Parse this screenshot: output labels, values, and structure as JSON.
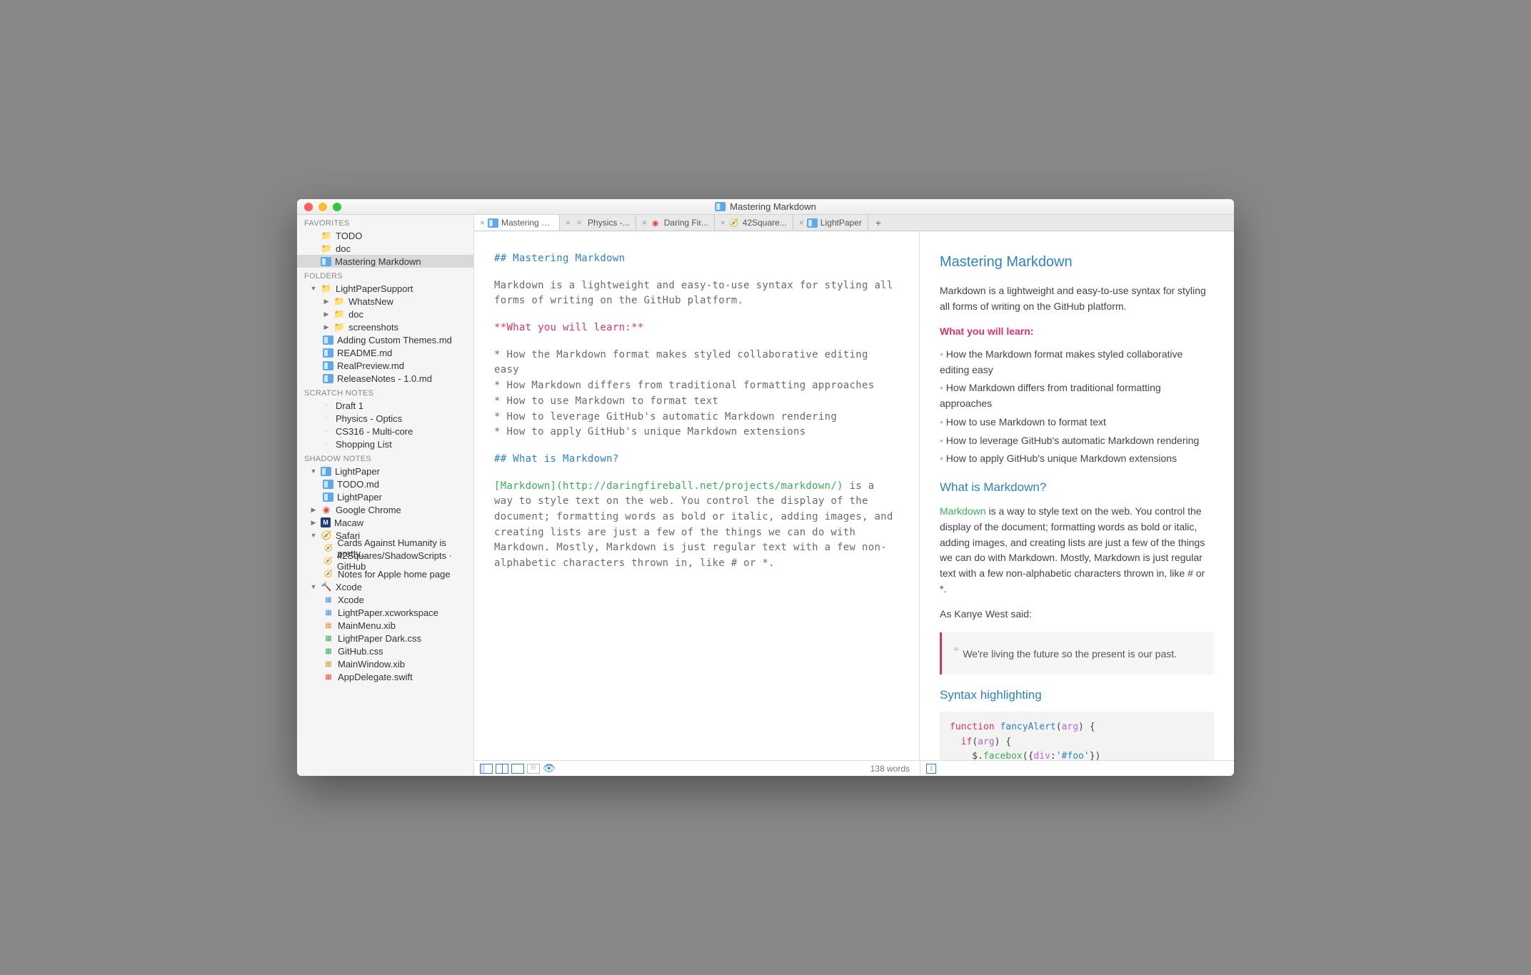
{
  "window": {
    "title": "Mastering Markdown"
  },
  "sidebar": {
    "favorites_h": "FAVORITES",
    "favorites": [
      {
        "label": "TODO",
        "icon": "folder"
      },
      {
        "label": "doc",
        "icon": "folder"
      },
      {
        "label": "Mastering Markdown",
        "icon": "app",
        "selected": true
      }
    ],
    "folders_h": "FOLDERS",
    "folders": [
      {
        "label": "LightPaperSupport",
        "icon": "folder",
        "disc": "▼",
        "depth": 1
      },
      {
        "label": "WhatsNew",
        "icon": "folder",
        "disc": "▶",
        "depth": 2
      },
      {
        "label": "doc",
        "icon": "folder",
        "disc": "▶",
        "depth": 2
      },
      {
        "label": "screenshots",
        "icon": "folder",
        "disc": "▶",
        "depth": 2
      },
      {
        "label": "Adding Custom Themes.md",
        "icon": "app",
        "depth": 2
      },
      {
        "label": "README.md",
        "icon": "app",
        "depth": 2
      },
      {
        "label": "RealPreview.md",
        "icon": "app",
        "depth": 2
      },
      {
        "label": "ReleaseNotes - 1.0.md",
        "icon": "app",
        "depth": 2
      }
    ],
    "scratch_h": "SCRATCH NOTES",
    "scratch": [
      {
        "label": "Draft 1"
      },
      {
        "label": "Physics - Optics"
      },
      {
        "label": "CS316 - Multi-core"
      },
      {
        "label": "Shopping List"
      }
    ],
    "shadow_h": "SHADOW NOTES",
    "shadow": [
      {
        "label": "LightPaper",
        "icon": "app",
        "disc": "▼",
        "depth": 1
      },
      {
        "label": "TODO.md",
        "icon": "app",
        "depth": 2
      },
      {
        "label": "LightPaper",
        "icon": "app",
        "depth": 2
      },
      {
        "label": "Google Chrome",
        "icon": "chrome",
        "disc": "▶",
        "depth": 1
      },
      {
        "label": "Macaw",
        "icon": "macaw",
        "disc": "▶",
        "depth": 1
      },
      {
        "label": "Safari",
        "icon": "safari",
        "disc": "▼",
        "depth": 1
      },
      {
        "label": "Cards Against Humanity is pretty...",
        "icon": "safaridoc",
        "depth": 2
      },
      {
        "label": "42Squares/ShadowScripts · GitHub",
        "icon": "safaridoc",
        "depth": 2
      },
      {
        "label": "Notes for Apple home page",
        "icon": "safaridoc",
        "depth": 2
      },
      {
        "label": "Xcode",
        "icon": "xcode",
        "disc": "▼",
        "depth": 1
      },
      {
        "label": "Xcode",
        "icon": "xcodefile",
        "depth": 2
      },
      {
        "label": "LightPaper.xcworkspace",
        "icon": "xcodefile",
        "depth": 2
      },
      {
        "label": "MainMenu.xib",
        "icon": "xib",
        "depth": 2
      },
      {
        "label": "LightPaper Dark.css",
        "icon": "css",
        "depth": 2
      },
      {
        "label": "GitHub.css",
        "icon": "css",
        "depth": 2
      },
      {
        "label": "MainWindow.xib",
        "icon": "xib",
        "depth": 2
      },
      {
        "label": "AppDelegate.swift",
        "icon": "swift",
        "depth": 2
      }
    ]
  },
  "tabs": [
    {
      "label": "Mastering Mar...",
      "icon": "app",
      "active": true
    },
    {
      "label": "Physics -...",
      "icon": "text"
    },
    {
      "label": "Daring Fir...",
      "icon": "chrome"
    },
    {
      "label": "42Square...",
      "icon": "safari"
    },
    {
      "label": "LightPaper",
      "icon": "app"
    }
  ],
  "editor": {
    "h1": "## Mastering Markdown",
    "p1": "Markdown is a lightweight and easy-to-use syntax for styling all forms of writing on the GitHub platform.",
    "learn": "**What you will learn:**",
    "b1": "* How the Markdown format makes styled collaborative editing easy",
    "b2": "* How Markdown differs from traditional formatting approaches",
    "b3": "* How to use Markdown to format text",
    "b4": "* How to leverage GitHub's automatic Markdown rendering",
    "b5": "* How to apply GitHub's unique Markdown extensions",
    "h2": "## What is Markdown?",
    "link": "[Markdown](http://daringfireball.net/projects/markdown/)",
    "p2": " is a way to style text on the web. You control the display of the document; formatting words as bold or italic, adding images, and creating lists are just a few of the things we can do with Markdown. Mostly, Markdown is just regular text with a few non-alphabetic characters thrown in, like # or *."
  },
  "preview": {
    "h1": "Mastering Markdown",
    "p1": "Markdown is a lightweight and easy-to-use syntax for styling all forms of writing on the GitHub platform.",
    "learn": "What you will learn:",
    "b1": "How the Markdown format makes styled collaborative editing easy",
    "b2": "How Markdown differs from traditional formatting approaches",
    "b3": "How to use Markdown to format text",
    "b4": "How to leverage GitHub's automatic Markdown rendering",
    "b5": "How to apply GitHub's unique Markdown extensions",
    "h2": "What is Markdown?",
    "linktext": "Markdown",
    "p2": " is a way to style text on the web. You control the display of the document; formatting words as bold or italic, adding images, and creating lists are just a few of the things we can do with Markdown. Mostly, Markdown is just regular text with a few non-alphabetic characters thrown in, like # or *.",
    "kanye_intro": "As Kanye West said:",
    "quote": "We're living the future so the present is our past.",
    "h3": "Syntax highlighting",
    "code_kw1": "function",
    "code_fn": "fancyAlert",
    "code_arg": "arg",
    "code_kw2": "if",
    "code_prop": "facebox",
    "code_div": "div",
    "code_str": "'#foo'"
  },
  "status": {
    "words": "138 words",
    "r": "R"
  }
}
